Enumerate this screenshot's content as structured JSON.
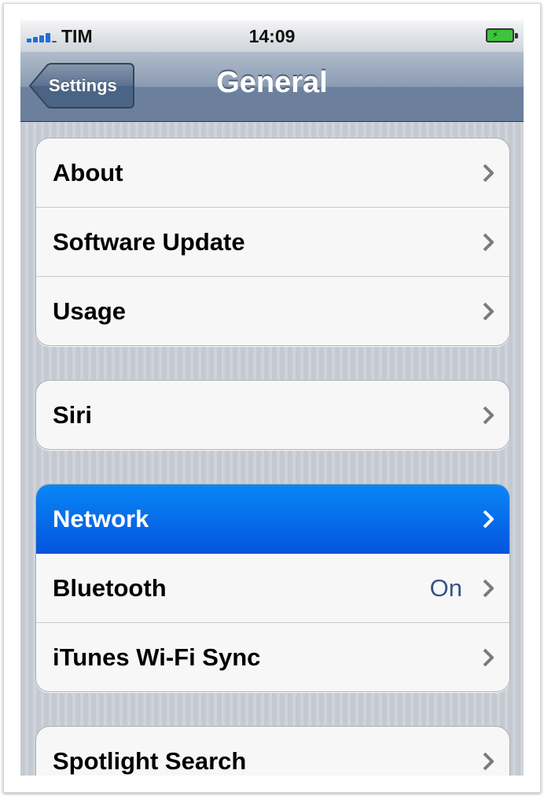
{
  "status_bar": {
    "carrier": "TIM",
    "time": "14:09",
    "icons": [
      "signal-icon",
      "battery-charging-icon"
    ]
  },
  "nav_bar": {
    "back_label": "Settings",
    "title": "General"
  },
  "groups": [
    [
      {
        "label": "About"
      },
      {
        "label": "Software Update"
      },
      {
        "label": "Usage"
      }
    ],
    [
      {
        "label": "Siri"
      }
    ],
    [
      {
        "label": "Network",
        "selected": true
      },
      {
        "label": "Bluetooth",
        "value": "On"
      },
      {
        "label": "iTunes Wi-Fi Sync"
      }
    ],
    [
      {
        "label": "Spotlight Search"
      }
    ]
  ],
  "colors": {
    "nav_bar": "#7d8fa9",
    "selection": "#0a6fe8",
    "value_text": "#385487"
  }
}
